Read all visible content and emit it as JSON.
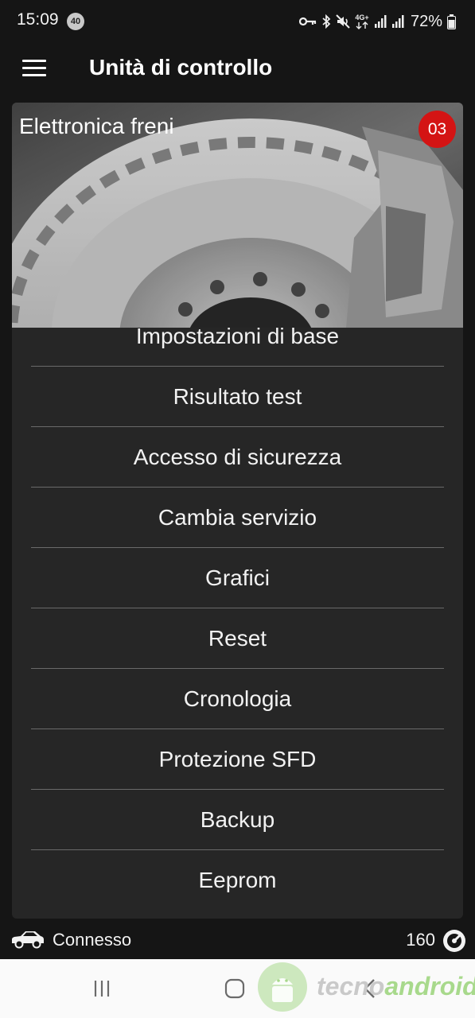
{
  "status_bar": {
    "time": "15:09",
    "notification_count": "40",
    "network_type": "4G+",
    "battery": "72%"
  },
  "app_bar": {
    "title": "Unità di controllo",
    "menu_icon": "hamburger-menu-icon"
  },
  "module": {
    "name": "Elettronica freni",
    "address": "03",
    "badge_color": "#d41414"
  },
  "menu": {
    "items": [
      {
        "label": "Impostazioni di base"
      },
      {
        "label": "Risultato test"
      },
      {
        "label": "Accesso di sicurezza"
      },
      {
        "label": "Cambia servizio"
      },
      {
        "label": "Grafici"
      },
      {
        "label": "Reset"
      },
      {
        "label": "Cronologia"
      },
      {
        "label": "Protezione SFD"
      },
      {
        "label": "Backup"
      },
      {
        "label": "Eeprom"
      }
    ]
  },
  "footer": {
    "connection_status": "Connesso",
    "count": "160",
    "car_icon": "car-icon",
    "gauge_icon": "gauge-icon"
  },
  "watermark": {
    "part1": "tecno",
    "part2": "android"
  },
  "colors": {
    "background": "#151515",
    "card": "#262626",
    "accent": "#d41414"
  }
}
